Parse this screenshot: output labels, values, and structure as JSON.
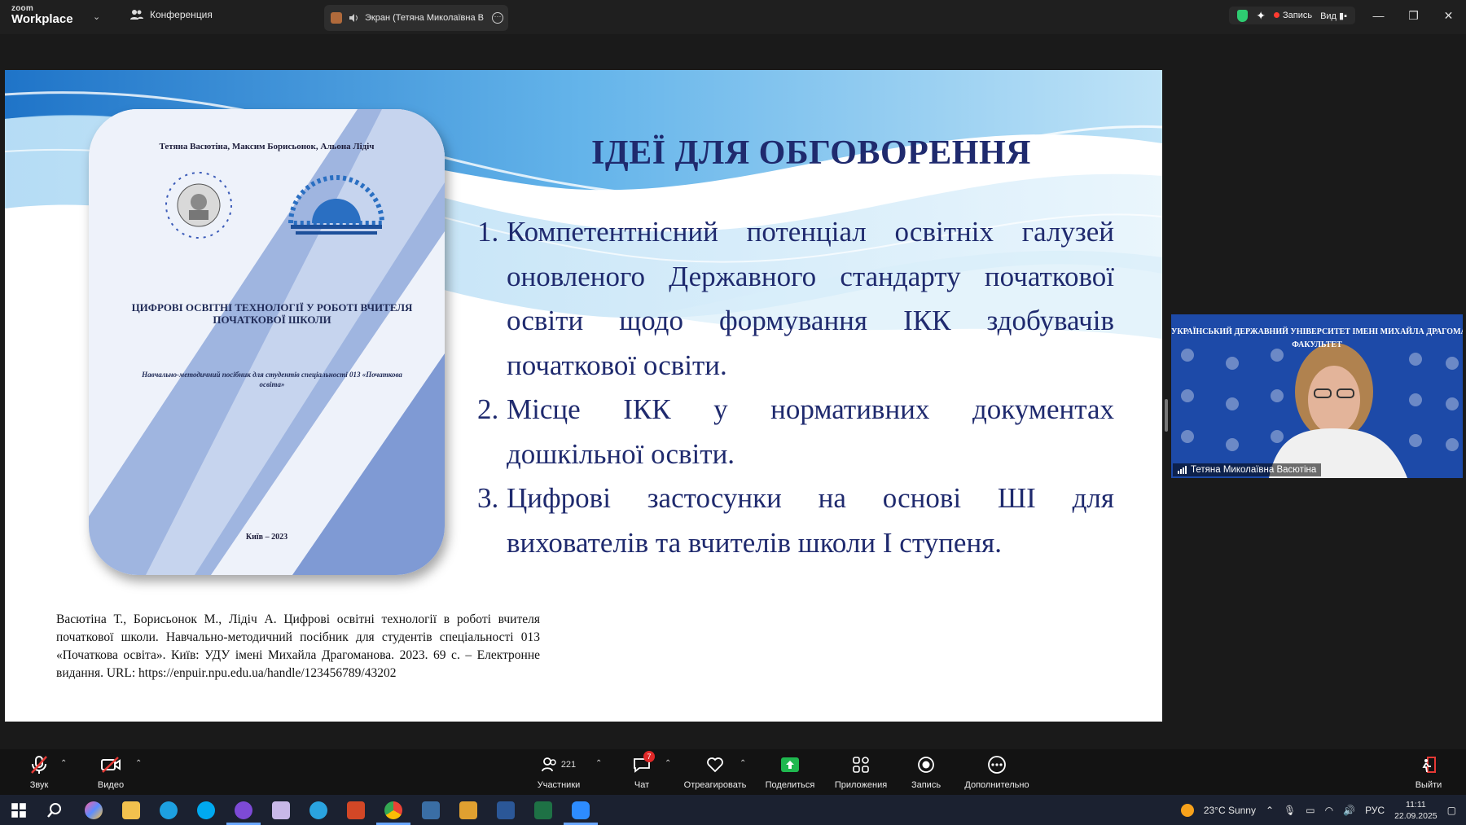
{
  "app": {
    "brand_small": "zoom",
    "brand_big": "Workplace"
  },
  "tabs": {
    "conference_label": "Конференция",
    "share_label": "Экран (Тетяна Миколаївна В"
  },
  "topbar_right": {
    "record_label": "Запись",
    "view_label": "Вид"
  },
  "slide": {
    "book": {
      "authors": "Тетяна Васютіна, Максим Борисьонок, Альона Лідіч",
      "title": "ЦИФРОВІ ОСВІТНІ ТЕХНОЛОГІЇ У РОБОТІ ВЧИТЕЛЯ ПОЧАТКОВОЇ ШКОЛИ",
      "subtitle": "Навчально-методичний посібник для студентів спеціальності 013 «Початкова освіта»",
      "city_year": "Київ – 2023"
    },
    "title": "ІДЕЇ ДЛЯ ОБГОВОРЕННЯ",
    "ideas": [
      {
        "num": "1.",
        "text": "Компетентнісний потенціал освітніх галузей оновленого Державного стандарту початкової освіти щодо формування ІКК здобувачів початкової освіти."
      },
      {
        "num": "2.",
        "text": "Місце ІКК у нормативних документах дошкільної освіти."
      },
      {
        "num": "3.",
        "text": "Цифрові застосунки на основі ШІ для вихователів та вчителів школи І ступеня."
      }
    ],
    "citation": "Васютіна Т., Борисьонок М., Лідіч А. Цифрові освітні технології в роботі вчителя початкової школи. Навчально-методичний посібник для студентів спеціальності 013 «Початкова освіта». Київ: УДУ імені Михайла Драгоманова. 2023. 69 с. – Електронне видання. URL: https://enpuir.npu.edu.ua/handle/123456789/43202"
  },
  "video": {
    "banner_line1": "УКРАЇНСЬКИЙ ДЕРЖАВНИЙ УНІВЕРСИТЕТ ІМЕНІ МИХАЙЛА ДРАГОМАНОВА",
    "banner_line2": "ФАКУЛЬТЕТ",
    "participant_name": "Тетяна Миколаївна Васютіна"
  },
  "toolbar": {
    "audio": "Звук",
    "video": "Видео",
    "participants": "Участники",
    "participants_count": "221",
    "chat": "Чат",
    "chat_badge": "7",
    "react": "Отреагировать",
    "share": "Поделиться",
    "apps": "Приложения",
    "record": "Запись",
    "more": "Дополнительно",
    "leave": "Выйти"
  },
  "taskbar": {
    "weather": "23°C  Sunny",
    "lang": "РУС",
    "time": "11:11",
    "date": "22.09.2025"
  },
  "colors": {
    "slide_title": "#1f2a6e",
    "share_green": "#1fb84f",
    "record_red": "#ff3b30",
    "video_bg": "#1d4aa8"
  }
}
